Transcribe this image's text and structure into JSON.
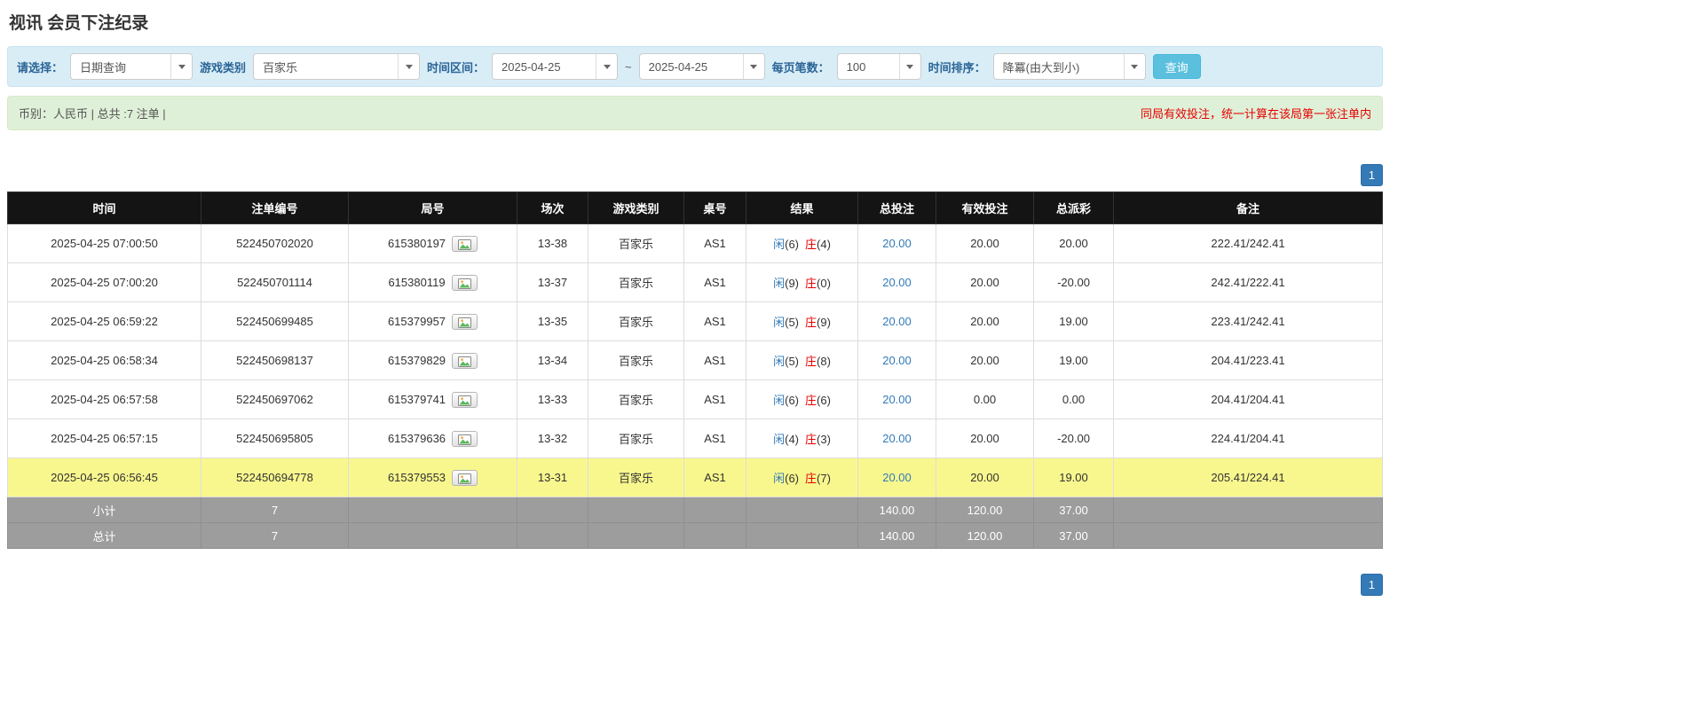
{
  "page": {
    "title": "视讯 会员下注纪录"
  },
  "filters": {
    "select_label": "请选择：",
    "select_value": "日期查询",
    "game_type_label": "游戏类别",
    "game_type_value": "百家乐",
    "date_range_label": "时间区间：",
    "date_from": "2025-04-25",
    "date_separator": "~",
    "date_to": "2025-04-25",
    "page_size_label": "每页笔数：",
    "page_size_value": "100",
    "sort_label": "时间排序：",
    "sort_value": "降冪(由大到小)",
    "search_button": "查询"
  },
  "summary": {
    "left": "币别：人民币 | 总共 :7 注单 |",
    "right_note": "同局有效投注，统一计算在该局第一张注单内"
  },
  "pagination": {
    "page": "1"
  },
  "colors": {
    "accent_blue": "#337ab7",
    "player_blue": "#337ab7",
    "banker_red": "#e60000",
    "negative_red": "#e60000",
    "highlight_yellow": "#f8f78e",
    "header_black": "#141414",
    "footer_gray": "#9d9d9d",
    "filter_bar_bg": "#d9edf7",
    "summary_bar_bg": "#dff0d8",
    "search_button_bg": "#5bc0de"
  },
  "icons": {
    "combo_caret": "chevron-down-icon",
    "round_media": "image-icon"
  },
  "table": {
    "headers": [
      "时间",
      "注单编号",
      "局号",
      "场次",
      "游戏类别",
      "桌号",
      "结果",
      "总投注",
      "有效投注",
      "总派彩",
      "备注"
    ],
    "rows": [
      {
        "time": "2025-04-25 07:00:50",
        "bet_id": "522450702020",
        "round_id": "615380197",
        "session": "13-38",
        "game": "百家乐",
        "table_no": "AS1",
        "result": {
          "player_label": "闲",
          "player_score": "(6)",
          "banker_label": "庄",
          "banker_score": "(4)"
        },
        "total_bet": "20.00",
        "valid_bet": "20.00",
        "payout": "20.00",
        "note": "222.41/242.41",
        "highlighted": false
      },
      {
        "time": "2025-04-25 07:00:20",
        "bet_id": "522450701114",
        "round_id": "615380119",
        "session": "13-37",
        "game": "百家乐",
        "table_no": "AS1",
        "result": {
          "player_label": "闲",
          "player_score": "(9)",
          "banker_label": "庄",
          "banker_score": "(0)"
        },
        "total_bet": "20.00",
        "valid_bet": "20.00",
        "payout": "-20.00",
        "note": "242.41/222.41",
        "highlighted": false
      },
      {
        "time": "2025-04-25 06:59:22",
        "bet_id": "522450699485",
        "round_id": "615379957",
        "session": "13-35",
        "game": "百家乐",
        "table_no": "AS1",
        "result": {
          "player_label": "闲",
          "player_score": "(5)",
          "banker_label": "庄",
          "banker_score": "(9)"
        },
        "total_bet": "20.00",
        "valid_bet": "20.00",
        "payout": "19.00",
        "note": "223.41/242.41",
        "highlighted": false
      },
      {
        "time": "2025-04-25 06:58:34",
        "bet_id": "522450698137",
        "round_id": "615379829",
        "session": "13-34",
        "game": "百家乐",
        "table_no": "AS1",
        "result": {
          "player_label": "闲",
          "player_score": "(5)",
          "banker_label": "庄",
          "banker_score": "(8)"
        },
        "total_bet": "20.00",
        "valid_bet": "20.00",
        "payout": "19.00",
        "note": "204.41/223.41",
        "highlighted": false
      },
      {
        "time": "2025-04-25 06:57:58",
        "bet_id": "522450697062",
        "round_id": "615379741",
        "session": "13-33",
        "game": "百家乐",
        "table_no": "AS1",
        "result": {
          "player_label": "闲",
          "player_score": "(6)",
          "banker_label": "庄",
          "banker_score": "(6)"
        },
        "total_bet": "20.00",
        "valid_bet": "0.00",
        "payout": "0.00",
        "note": "204.41/204.41",
        "highlighted": false
      },
      {
        "time": "2025-04-25 06:57:15",
        "bet_id": "522450695805",
        "round_id": "615379636",
        "session": "13-32",
        "game": "百家乐",
        "table_no": "AS1",
        "result": {
          "player_label": "闲",
          "player_score": "(4)",
          "banker_label": "庄",
          "banker_score": "(3)"
        },
        "total_bet": "20.00",
        "valid_bet": "20.00",
        "payout": "-20.00",
        "note": "224.41/204.41",
        "highlighted": false
      },
      {
        "time": "2025-04-25 06:56:45",
        "bet_id": "522450694778",
        "round_id": "615379553",
        "session": "13-31",
        "game": "百家乐",
        "table_no": "AS1",
        "result": {
          "player_label": "闲",
          "player_score": "(6)",
          "banker_label": "庄",
          "banker_score": "(7)"
        },
        "total_bet": "20.00",
        "valid_bet": "20.00",
        "payout": "19.00",
        "note": "205.41/224.41",
        "highlighted": true
      }
    ],
    "summary_rows": [
      {
        "label": "小计",
        "count": "7",
        "total_bet": "140.00",
        "valid_bet": "120.00",
        "payout": "37.00"
      },
      {
        "label": "总计",
        "count": "7",
        "total_bet": "140.00",
        "valid_bet": "120.00",
        "payout": "37.00"
      }
    ]
  }
}
